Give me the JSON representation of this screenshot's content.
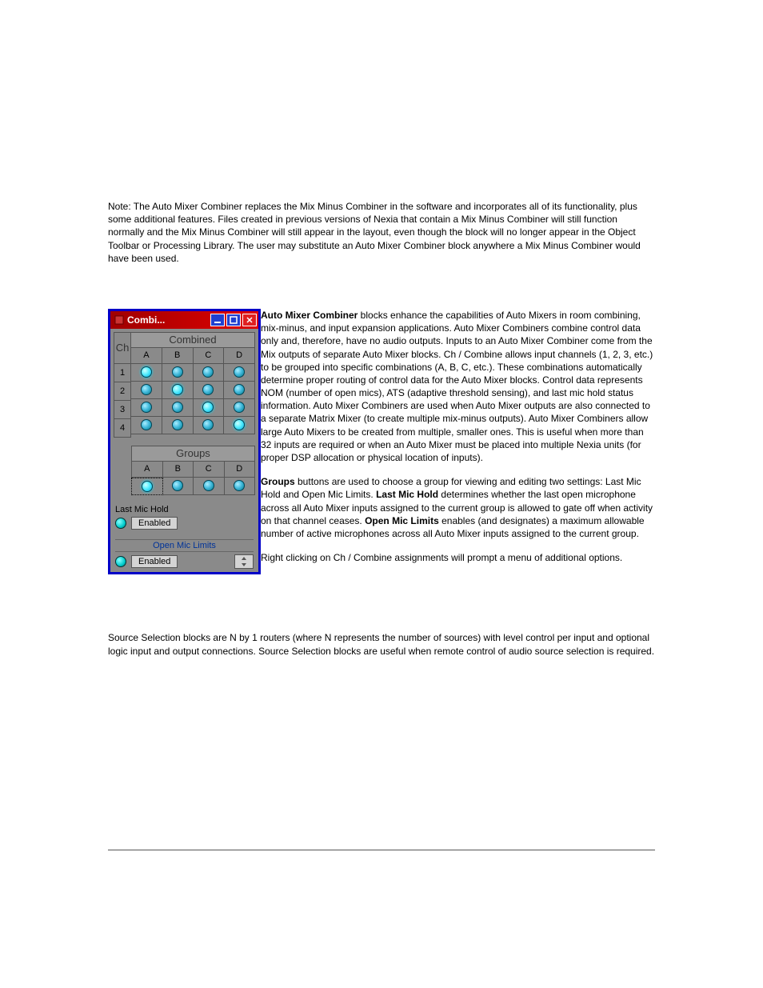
{
  "section1": {
    "title": "Auto Mixer Combiner"
  },
  "note": "Note: The Auto Mixer Combiner replaces the Mix Minus Combiner in the software and incorporates all of its functionality, plus some additional features. Files created in previous versions of Nexia that contain a Mix Minus Combiner will still function normally and the Mix Minus Combiner will still appear in the layout, even though the block will no longer appear in the Object Toolbar or Processing Library. The user may substitute an Auto Mixer Combiner block anywhere a Mix Minus Combiner would have been used.",
  "window": {
    "title": "Combi...",
    "combined": {
      "title": "Combined",
      "ch_label": "Ch",
      "cols": [
        "A",
        "B",
        "C",
        "D"
      ],
      "rows": [
        "1",
        "2",
        "3",
        "4"
      ],
      "lit": [
        [
          0,
          0
        ],
        [
          1,
          1
        ],
        [
          2,
          2
        ],
        [
          3,
          3
        ]
      ]
    },
    "groups": {
      "title": "Groups",
      "cols": [
        "A",
        "B",
        "C",
        "D"
      ],
      "selected_index": 0
    },
    "last_mic_hold": {
      "label": "Last Mic Hold",
      "value": "Enabled"
    },
    "open_mic_limits": {
      "label": "Open Mic Limits",
      "value": "Enabled"
    }
  },
  "desc": {
    "p1_lead": "Auto Mixer Combiner",
    "p1": " blocks enhance the capabilities of Auto Mixers in room combining, mix-minus, and input expansion applications. Auto Mixer Combiners combine control data only and, therefore, have no audio outputs. Inputs to an Auto Mixer Combiner come from the Mix outputs of separate Auto Mixer blocks. Ch / Combine allows input channels (1, 2, 3, etc.) to be grouped into specific combinations (A, B, C, etc.). These combinations automatically determine proper routing of control data for the Auto Mixer blocks. Control data represents NOM (number of open mics), ATS (adaptive threshold sensing), and last mic hold status information. Auto Mixer Combiners are used when Auto Mixer outputs are also connected to a separate Matrix Mixer (to create multiple mix-minus outputs). Auto Mixer Combiners allow large Auto Mixers to be created from multiple, smaller ones. This is useful when more than 32 inputs are required or when an Auto Mixer must be placed into multiple Nexia units (for proper DSP allocation or physical location of inputs).",
    "p2_lead": "Groups",
    "p2a": " buttons are used to choose a group for viewing and editing two settings: Last Mic Hold and Open Mic Limits. ",
    "p2_bold1": "Last Mic Hold",
    "p2b": " determines whether the last open microphone across all Auto Mixer inputs assigned to the current group is allowed to gate off when activity on that channel ceases. ",
    "p2_bold2": "Open Mic Limits",
    "p2c": " enables (and designates) a maximum allowable number of active microphones across all Auto Mixer inputs assigned to the current group.",
    "p3": "Right clicking on Ch / Combine assignments will prompt a menu of additional options."
  },
  "section2": {
    "title": "Source Selection",
    "para": "Source Selection blocks are N by 1 routers (where N represents the number of sources) with level control per input and optional logic input and output connections. Source Selection blocks are useful when remote control of audio source selection is required."
  }
}
